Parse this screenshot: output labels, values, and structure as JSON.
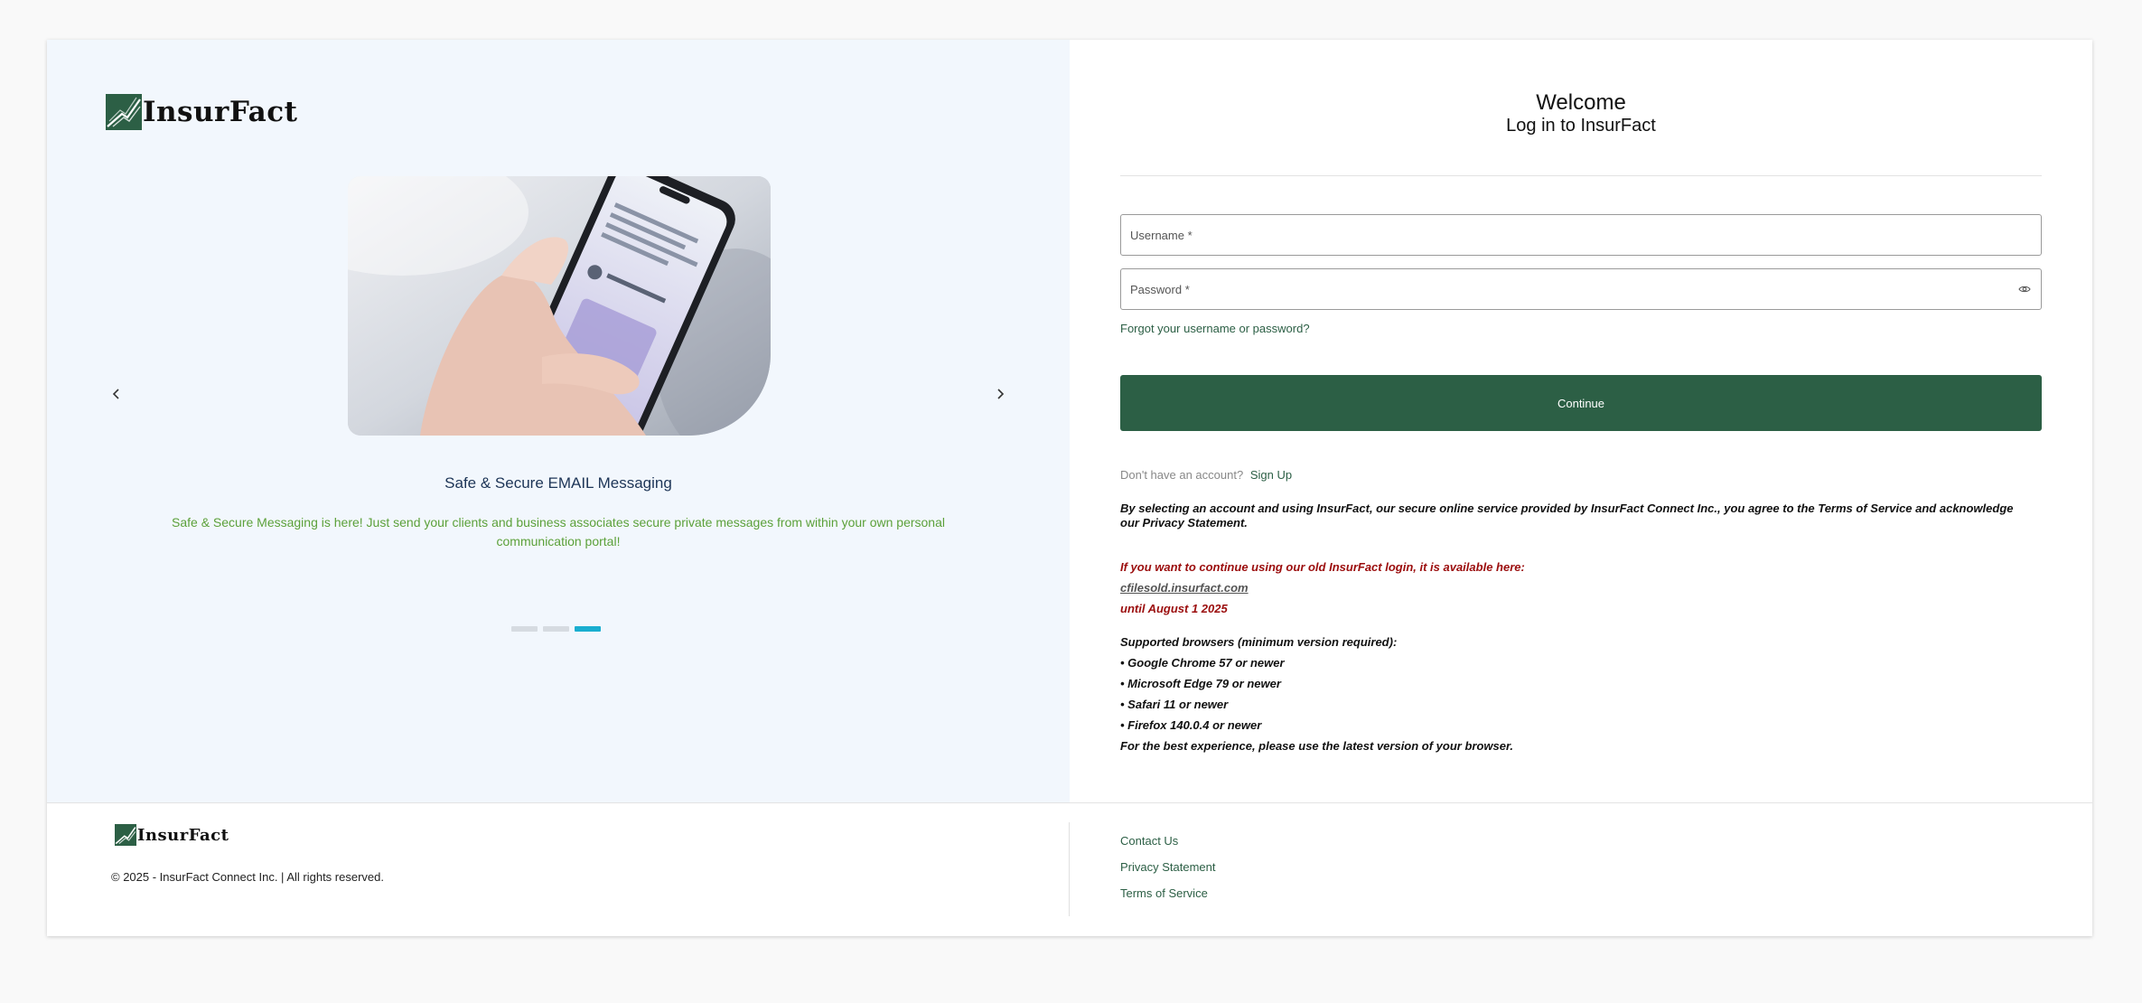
{
  "brand": {
    "name": "InsurFact",
    "primary_color": "#2c5f45"
  },
  "carousel": {
    "image_alt": "Hand holding a smartphone",
    "prev_icon": "chevron-left-icon",
    "next_icon": "chevron-right-icon",
    "slide_title": "Safe & Secure EMAIL Messaging",
    "slide_description": "Safe & Secure Messaging is here! Just send your clients and business associates secure private messages from within your own personal communication portal!",
    "total_slides": 3,
    "active_slide": 3,
    "active_color": "#1aaed0"
  },
  "login": {
    "welcome": "Welcome",
    "subtitle": "Log in to InsurFact",
    "username_placeholder": "Username *",
    "password_placeholder": "Password *",
    "forgot_link": "Forgot your username or password?",
    "continue_label": "Continue",
    "no_account_prompt": "Don't have an account?",
    "signup_label": "Sign Up",
    "agreement": "By selecting an account and using InsurFact, our secure online service provided by InsurFact Connect Inc., you agree to the Terms of Service and acknowledge our Privacy Statement.",
    "old_login_notice": "If you want to continue using our old InsurFact login, it is available here:",
    "old_login_link": "cfilesold.insurfact.com",
    "old_login_until": "until August 1 2025",
    "browsers_heading": "Supported browsers (minimum version required):",
    "browsers": [
      "• Google Chrome 57 or newer",
      "• Microsoft Edge 79 or newer",
      "• Safari 11 or newer",
      "• Firefox 140.0.4 or newer"
    ],
    "browsers_footer": "For the best experience, please use the latest version of your browser."
  },
  "footer": {
    "copyright": "© 2025 - InsurFact Connect Inc. | All rights reserved.",
    "links": [
      "Contact Us",
      "Privacy Statement",
      "Terms of Service"
    ]
  }
}
